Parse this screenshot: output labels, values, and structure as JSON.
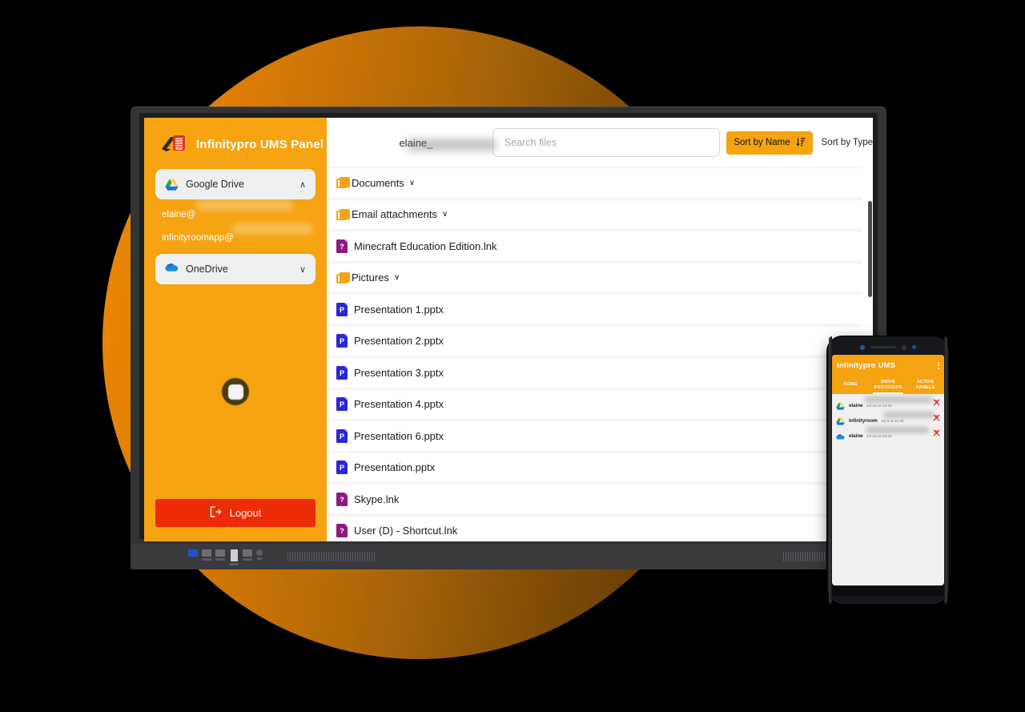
{
  "app": {
    "brand_title": "Infinitypro UMS Panel",
    "logo_badge_text": "UMS"
  },
  "sidebar": {
    "providers": [
      {
        "name": "Google Drive",
        "icon": "google-drive-icon",
        "expanded": true,
        "chevron": "∧"
      },
      {
        "name": "OneDrive",
        "icon": "onedrive-icon",
        "expanded": false,
        "chevron": "∨"
      }
    ],
    "accounts": [
      {
        "label": "elaine@",
        "redacted": true
      },
      {
        "label": "infinityroomapp@",
        "redacted": true
      }
    ],
    "logout_label": "Logout",
    "logout_icon": "logout-icon",
    "logout_color": "#EE2B08",
    "spinner_icon": "loading-spinner"
  },
  "topbar": {
    "account_label": "elaine_",
    "account_redacted": true,
    "search": {
      "placeholder": "Search files",
      "value": "",
      "icon": "search-input"
    },
    "sort_by_name_label": "Sort by Name",
    "sort_by_name_icon": "sort-descending-icon",
    "sort_by_type_label": "Sort by Type"
  },
  "files": [
    {
      "name": "Documents",
      "type": "folder",
      "chevron": "∨"
    },
    {
      "name": "Email attachments",
      "type": "folder",
      "chevron": "∨"
    },
    {
      "name": "Minecraft Education Edition.lnk",
      "type": "lnk",
      "badge": "?"
    },
    {
      "name": "Pictures",
      "type": "folder",
      "chevron": "∨"
    },
    {
      "name": "Presentation 1.pptx",
      "type": "pptx",
      "badge": "P"
    },
    {
      "name": "Presentation 2.pptx",
      "type": "pptx",
      "badge": "P"
    },
    {
      "name": "Presentation 3.pptx",
      "type": "pptx",
      "badge": "P"
    },
    {
      "name": "Presentation 4.pptx",
      "type": "pptx",
      "badge": "P"
    },
    {
      "name": "Presentation 6.pptx",
      "type": "pptx",
      "badge": "P"
    },
    {
      "name": "Presentation.pptx",
      "type": "pptx",
      "badge": "P"
    },
    {
      "name": "Skype.lnk",
      "type": "lnk",
      "badge": "?"
    },
    {
      "name": "User (D) - Shortcut.lnk",
      "type": "lnk",
      "badge": "?"
    }
  ],
  "phone": {
    "header_title": "Infinitypro  UMS",
    "menu_icon": "kebab-menu-icon",
    "tabs": [
      {
        "label": "HOME",
        "active": false
      },
      {
        "label": "DRIVE PROVIDERS",
        "active": true
      },
      {
        "label": "ACTIVE PANELS",
        "active": false
      }
    ],
    "linked_accounts": [
      {
        "name": "elaine",
        "icon": "google-drive-icon",
        "timestamp": "Jul 12 at 14:16",
        "action_icon": "unlink-icon",
        "redacted": true
      },
      {
        "name": "infinityroom",
        "icon": "google-drive-icon",
        "timestamp": "Jul 5 at 11:40",
        "action_icon": "unlink-icon",
        "redacted": true
      },
      {
        "name": "elaine",
        "icon": "onedrive-icon",
        "timestamp": "Jul 12 at 14:13",
        "action_icon": "unlink-icon",
        "redacted": true
      }
    ]
  },
  "theme": {
    "brand_orange": "#F5A310",
    "logout_red": "#EE2B08",
    "background_gradient_from": "#EF8B05",
    "background_gradient_to": "#4E2E05",
    "pptx_blue": "#2B27D6",
    "lnk_purple": "#8E1A7E"
  }
}
